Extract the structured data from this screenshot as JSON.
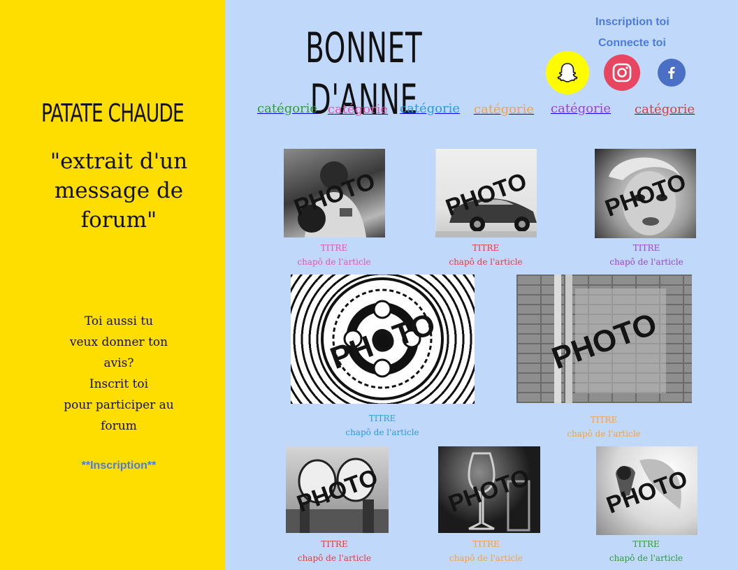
{
  "sidebar": {
    "title": "PATATE CHAUDE",
    "quote": "\"extrait d'un message de forum\"",
    "cta_lines": [
      "Toi aussi tu",
      "veux donner ton",
      "avis?",
      "Inscrit toi",
      "pour participer au",
      "forum"
    ],
    "link": "**Inscription**"
  },
  "header": {
    "logo": "BONNET D'ANNE",
    "signup": "Inscription toi",
    "login": "Connecte toi"
  },
  "social": {
    "snapchat": {
      "icon": "snapchat-icon",
      "color": "#fffc00"
    },
    "instagram": {
      "icon": "instagram-icon",
      "color": "#e84560"
    },
    "facebook": {
      "icon": "facebook-icon",
      "color": "#4a6fc4"
    }
  },
  "categories": [
    {
      "label": "catégorie",
      "color": "#2f9b3c"
    },
    {
      "label": "catégorie",
      "color": "#e354b1"
    },
    {
      "label": "catégorie",
      "color": "#2b9ae0"
    },
    {
      "label": "catégorie",
      "color": "#f6a13a"
    },
    {
      "label": "catégorie",
      "color": "#9b44cc"
    },
    {
      "label": "catégorie",
      "color": "#e8383c"
    }
  ],
  "articles": [
    {
      "photo": "PHOTO",
      "title": "TITRE",
      "chapo": "chapô de l'article",
      "color": "#e354b1"
    },
    {
      "photo": "PHOTO",
      "title": "TITRE",
      "chapo": "chapô de l'article",
      "color": "#e8383c"
    },
    {
      "photo": "PHOTO",
      "title": "TITRE",
      "chapo": "chapô de l'article",
      "color": "#9b44cc"
    },
    {
      "photo": "PHOTO",
      "title": "TITRE",
      "chapo": "chapô de l'article",
      "color": "#2b9ae0"
    },
    {
      "photo": "PHOTO",
      "title": "TITRE",
      "chapo": "chapô de l'article",
      "color": "#f6a13a"
    },
    {
      "photo": "PHOTO",
      "title": "TITRE",
      "chapo": "chapô de l'article",
      "color": "#e8383c"
    },
    {
      "photo": "PHOTO",
      "title": "TITRE",
      "chapo": "chapô de l'article",
      "color": "#f6a13a"
    },
    {
      "photo": "PHOTO",
      "title": "TITRE",
      "chapo": "chapô de l'article",
      "color": "#2f9b3c"
    }
  ]
}
